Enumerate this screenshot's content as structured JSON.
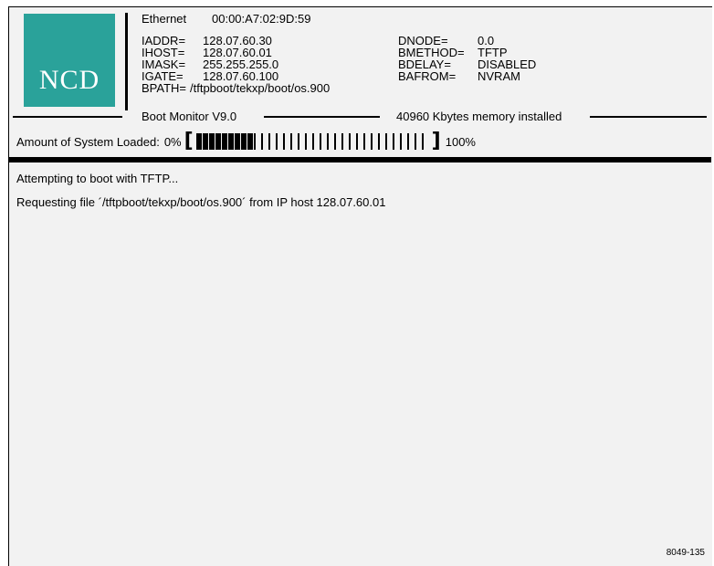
{
  "logo": {
    "text": "NCD"
  },
  "header": {
    "ethernet_label": "Ethernet",
    "ethernet_mac": "00:00:A7:02:9D:59"
  },
  "config_left": [
    {
      "key": "IADDR=",
      "value": "128.07.60.30"
    },
    {
      "key": "IHOST=",
      "value": "128.07.60.01"
    },
    {
      "key": "IMASK=",
      "value": "255.255.255.0"
    },
    {
      "key": "IGATE=",
      "value": "128.07.60.100"
    },
    {
      "key": "BPATH=",
      "value": "/tftpboot/tekxp/boot/os.900"
    }
  ],
  "config_right": [
    {
      "key": "DNODE=",
      "value": "0.0"
    },
    {
      "key": "BMETHOD=",
      "value": "TFTP"
    },
    {
      "key": "BDELAY=",
      "value": "DISABLED"
    },
    {
      "key": "BAFROM=",
      "value": "NVRAM"
    }
  ],
  "status_line": {
    "version": "Boot Monitor V9.0",
    "memory": "40960 Kbytes memory installed"
  },
  "progress": {
    "label": "Amount of System Loaded:",
    "start": "0%",
    "end": "100%",
    "filled_segments": 9,
    "total_segments": 33
  },
  "messages": [
    "Attempting to boot with TFTP...",
    "Requesting file ´/tftpboot/tekxp/boot/os.900´ from IP host 128.07.60.01"
  ],
  "figure_id": "8049-135",
  "colors": {
    "logo_bg": "#2aa29a",
    "screen_bg": "#f2f2f2"
  }
}
